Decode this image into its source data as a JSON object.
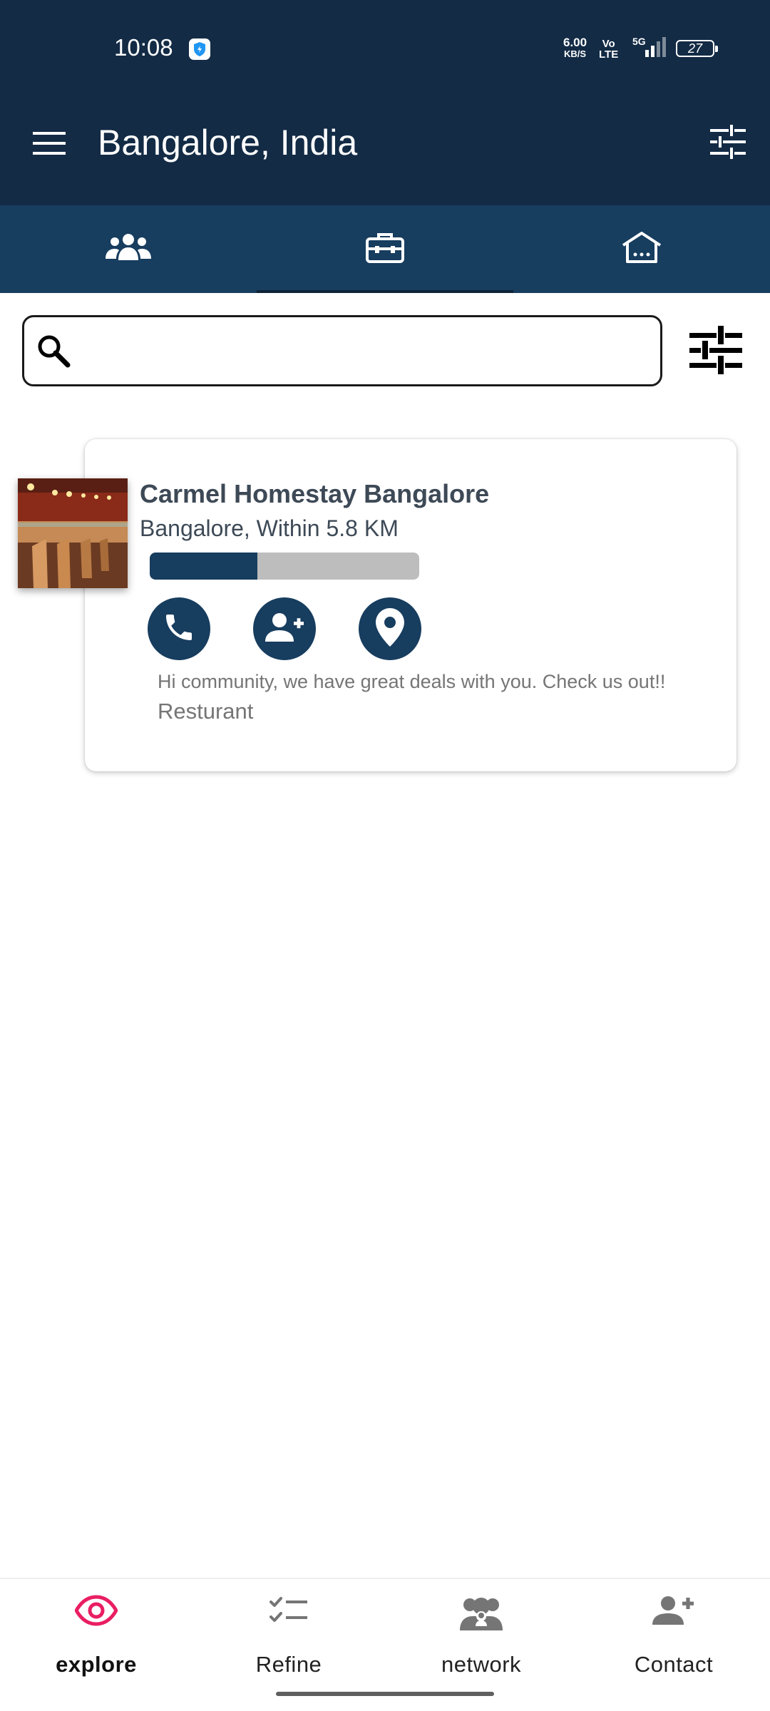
{
  "status_bar": {
    "time": "10:08",
    "net_speed_value": "6.00",
    "net_speed_unit": "KB/S",
    "volte_top": "Vo",
    "volte_bottom": "LTE",
    "network_type": "5G",
    "battery": "27"
  },
  "app_bar": {
    "title": "Bangalore, India",
    "menu_icon": "menu-icon",
    "tune_icon": "tune-icon"
  },
  "tabs": [
    {
      "icon": "people-icon",
      "active": false
    },
    {
      "icon": "briefcase-icon",
      "active": true
    },
    {
      "icon": "home-icon",
      "active": false
    }
  ],
  "search": {
    "placeholder": "",
    "value": ""
  },
  "listing": {
    "title": "Carmel Homestay Bangalore",
    "subtitle": "Bangalore, Within 5.8 KM",
    "progress": 0.4,
    "message": "Hi community, we have great deals with you. Check us out!!",
    "category": "Resturant",
    "actions": [
      "phone-icon",
      "add-contact-icon",
      "location-pin-icon"
    ]
  },
  "bottom_nav": {
    "items": [
      {
        "label": "explore",
        "icon": "eye-icon",
        "active": true
      },
      {
        "label": "Refine",
        "icon": "checklist-icon",
        "active": false
      },
      {
        "label": "network",
        "icon": "group-icon",
        "active": false
      },
      {
        "label": "Contact",
        "icon": "add-person-icon",
        "active": false
      }
    ]
  },
  "colors": {
    "primary_dark": "#132b45",
    "primary": "#173d5f",
    "accent": "#e91e63",
    "progress_track": "#bdbdbd"
  }
}
